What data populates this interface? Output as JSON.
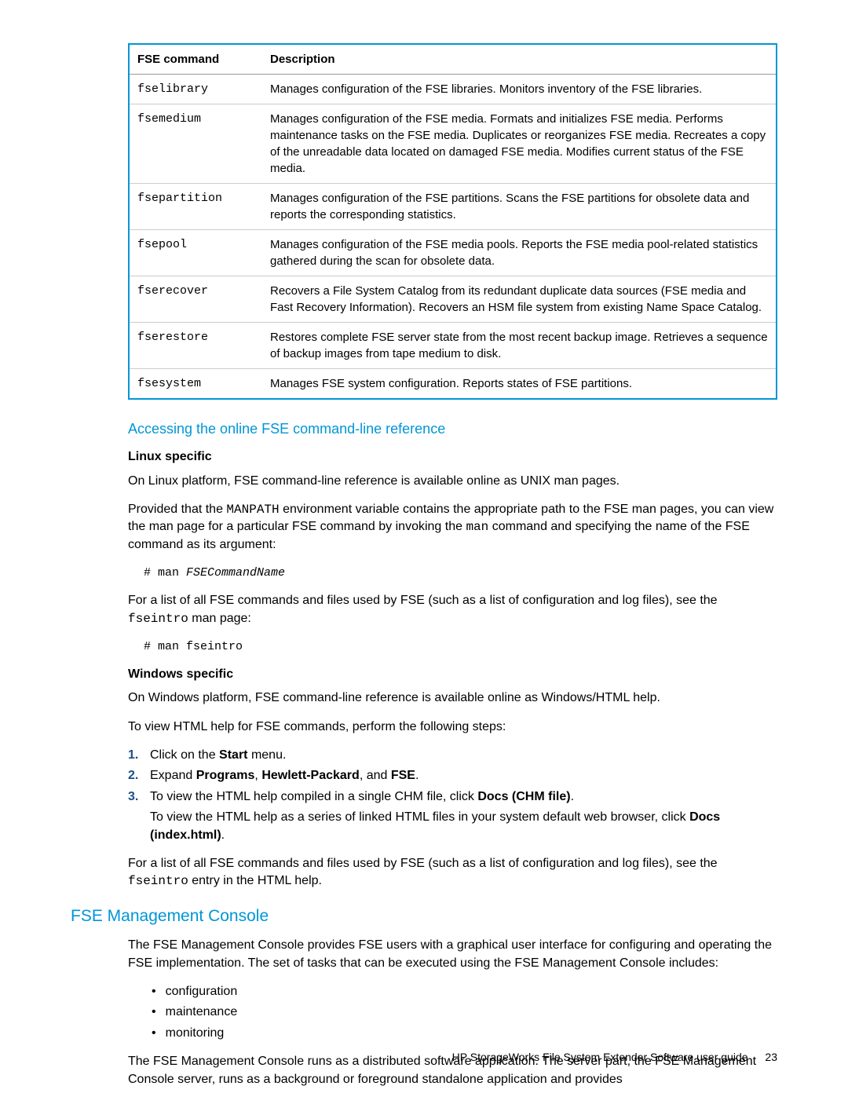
{
  "table": {
    "headers": {
      "cmd": "FSE command",
      "desc": "Description"
    },
    "rows": [
      {
        "cmd": "fselibrary",
        "desc": "Manages configuration of the FSE libraries. Monitors inventory of the FSE libraries."
      },
      {
        "cmd": "fsemedium",
        "desc": "Manages configuration of the FSE media. Formats and initializes FSE media. Performs maintenance tasks on the FSE media. Duplicates or reorganizes FSE media. Recreates a copy of the unreadable data located on damaged FSE media. Modifies current status of the FSE media."
      },
      {
        "cmd": "fsepartition",
        "desc": "Manages configuration of the FSE partitions. Scans the FSE partitions for obsolete data and reports the corresponding statistics."
      },
      {
        "cmd": "fsepool",
        "desc": "Manages configuration of the FSE media pools. Reports the FSE media pool-related statistics gathered during the scan for obsolete data."
      },
      {
        "cmd": "fserecover",
        "desc": "Recovers a File System Catalog from its redundant duplicate data sources (FSE media and Fast Recovery Information). Recovers an HSM file system from existing Name Space Catalog."
      },
      {
        "cmd": "fserestore",
        "desc": "Restores complete FSE server state from the most recent backup image. Retrieves a sequence of backup images from tape medium to disk."
      },
      {
        "cmd": "fsesystem",
        "desc": "Manages FSE system configuration. Reports states of FSE partitions."
      }
    ]
  },
  "section1": {
    "title": "Accessing the online FSE command-line reference",
    "linux_head": "Linux specific",
    "linux_p1": "On Linux platform, FSE command-line reference is available online as UNIX man pages.",
    "linux_p2a": "Provided that the ",
    "linux_p2_code1": "MANPATH",
    "linux_p2b": " environment variable contains the appropriate path to the FSE man pages, you can view the man page for a particular FSE command by invoking the ",
    "linux_p2_code2": "man",
    "linux_p2c": " command and specifying the name of the FSE command as its argument:",
    "code1a": "# man ",
    "code1b": "FSECommandName",
    "linux_p3a": "For a list of all FSE commands and files used by FSE (such as a list of configuration and log files), see the ",
    "linux_p3_code": "fseintro",
    "linux_p3b": " man page:",
    "code2": "# man fseintro",
    "win_head": "Windows specific",
    "win_p1": "On Windows platform, FSE command-line reference is available online as Windows/HTML help.",
    "win_p2": "To view HTML help for FSE commands, perform the following steps:",
    "steps": {
      "n1": "1.",
      "s1a": "Click on the ",
      "s1b": "Start",
      "s1c": " menu.",
      "n2": "2.",
      "s2a": "Expand ",
      "s2b": "Programs",
      "s2c": ", ",
      "s2d": "Hewlett-Packard",
      "s2e": ", and ",
      "s2f": "FSE",
      "s2g": ".",
      "n3": "3.",
      "s3a": "To view the HTML help compiled in a single CHM file, click ",
      "s3b": "Docs (CHM file)",
      "s3c": ".",
      "s3d": "To view the HTML help as a series of linked HTML files in your system default web browser, click ",
      "s3e": "Docs (index.html)",
      "s3f": "."
    },
    "win_p3a": "For a list of all FSE commands and files used by FSE (such as a list of configuration and log files), see the ",
    "win_p3_code": "fseintro",
    "win_p3b": " entry in the HTML help."
  },
  "section2": {
    "title": "FSE Management Console",
    "p1": "The FSE Management Console provides FSE users with a graphical user interface for configuring and operating the FSE implementation. The set of tasks that can be executed using the FSE Management Console includes:",
    "bullets": [
      "configuration",
      "maintenance",
      "monitoring"
    ],
    "p2": "The FSE Management Console runs as a distributed software application. The server part, the FSE Management Console server, runs as a background or foreground standalone application and provides"
  },
  "footer": {
    "text": "HP StorageWorks File System Extender Software user guide",
    "page": "23"
  }
}
